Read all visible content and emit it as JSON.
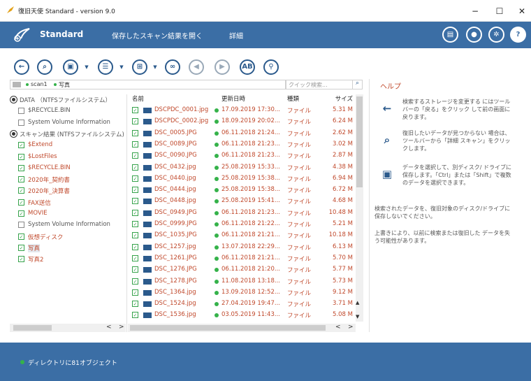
{
  "window": {
    "title": "復旧天使 Standard - version 9.0",
    "minimize": "−",
    "maximize": "☐",
    "close": "✕"
  },
  "header": {
    "brand": "Standard",
    "menu_open_scan": "保存したスキャン結果を開く",
    "menu_details": "詳細",
    "help_icon": "?"
  },
  "toolbar": {
    "case_button": "AB"
  },
  "breadcrumb": {
    "items": [
      "scan1",
      "写真"
    ]
  },
  "search": {
    "placeholder": "クイック検索..."
  },
  "tree": [
    {
      "label": "DATA （NTFSファイルシステム）",
      "type": "drive",
      "level": 0,
      "color": "grey"
    },
    {
      "label": "$RECYCLE.BIN",
      "type": "folder",
      "level": 1,
      "color": "grey"
    },
    {
      "label": "System Volume Information",
      "type": "folder",
      "level": 1,
      "color": "grey"
    },
    {
      "label": "スキャン結果 (NTFSファイルシステム)",
      "type": "drive",
      "level": 0,
      "color": "grey"
    },
    {
      "label": "$Extend",
      "type": "folder",
      "level": 1,
      "color": "red"
    },
    {
      "label": "$LostFiles",
      "type": "folder",
      "level": 1,
      "color": "red"
    },
    {
      "label": "$RECYCLE.BIN",
      "type": "folder",
      "level": 1,
      "color": "red"
    },
    {
      "label": "2020年_契約書",
      "type": "folder",
      "level": 1,
      "color": "red"
    },
    {
      "label": "2020年_決算書",
      "type": "folder",
      "level": 1,
      "color": "red"
    },
    {
      "label": "FAX送信",
      "type": "folder",
      "level": 1,
      "color": "red"
    },
    {
      "label": "MOVIE",
      "type": "folder",
      "level": 1,
      "color": "red"
    },
    {
      "label": "System Volume Information",
      "type": "folder",
      "level": 1,
      "color": "grey"
    },
    {
      "label": "仮想ディスク",
      "type": "folder",
      "level": 1,
      "color": "red"
    },
    {
      "label": "写真",
      "type": "folder",
      "level": 1,
      "color": "red",
      "selected": true
    },
    {
      "label": "写真2",
      "type": "folder",
      "level": 1,
      "color": "red"
    }
  ],
  "columns": {
    "name": "名前",
    "date": "更新日時",
    "kind": "種類",
    "size": "サイズ"
  },
  "files": [
    {
      "name": "DSCPDC_0001.jpg",
      "date": "17.09.2019 17:30...",
      "kind": "ファイル",
      "size": "5.31 M"
    },
    {
      "name": "DSCPDC_0002.jpg",
      "date": "18.09.2019 20:02...",
      "kind": "ファイル",
      "size": "6.24 M"
    },
    {
      "name": "DSC_0005.JPG",
      "date": "06.11.2018 21:24...",
      "kind": "ファイル",
      "size": "2.62 M"
    },
    {
      "name": "DSC_0089.JPG",
      "date": "06.11.2018 21:23...",
      "kind": "ファイル",
      "size": "3.02 M"
    },
    {
      "name": "DSC_0090.JPG",
      "date": "06.11.2018 21:23...",
      "kind": "ファイル",
      "size": "2.87 M"
    },
    {
      "name": "DSC_0432.jpg",
      "date": "25.08.2019 15:33...",
      "kind": "ファイル",
      "size": "4.38 M"
    },
    {
      "name": "DSC_0440.jpg",
      "date": "25.08.2019 15:38...",
      "kind": "ファイル",
      "size": "6.94 M"
    },
    {
      "name": "DSC_0444.jpg",
      "date": "25.08.2019 15:38...",
      "kind": "ファイル",
      "size": "6.72 M"
    },
    {
      "name": "DSC_0448.jpg",
      "date": "25.08.2019 15:41...",
      "kind": "ファイル",
      "size": "4.68 M"
    },
    {
      "name": "DSC_0949.JPG",
      "date": "06.11.2018 21:23...",
      "kind": "ファイル",
      "size": "10.48 M"
    },
    {
      "name": "DSC_0999.JPG",
      "date": "06.11.2018 21:22...",
      "kind": "ファイル",
      "size": "5.21 M"
    },
    {
      "name": "DSC_1035.JPG",
      "date": "06.11.2018 21:21...",
      "kind": "ファイル",
      "size": "10.18 M"
    },
    {
      "name": "DSC_1257.jpg",
      "date": "13.07.2018 22:29...",
      "kind": "ファイル",
      "size": "6.13 M"
    },
    {
      "name": "DSC_1261.JPG",
      "date": "06.11.2018 21:21...",
      "kind": "ファイル",
      "size": "5.70 M"
    },
    {
      "name": "DSC_1276.JPG",
      "date": "06.11.2018 21:20...",
      "kind": "ファイル",
      "size": "5.77 M"
    },
    {
      "name": "DSC_1278.JPG",
      "date": "11.08.2018 13:18...",
      "kind": "ファイル",
      "size": "5.73 M"
    },
    {
      "name": "DSC_1364.jpg",
      "date": "13.09.2018 12:52...",
      "kind": "ファイル",
      "size": "9.12 M"
    },
    {
      "name": "DSC_1524.jpg",
      "date": "27.04.2019 19:47...",
      "kind": "ファイル",
      "size": "3.71 M"
    },
    {
      "name": "DSC_1536.jpg",
      "date": "03.05.2019 11:43...",
      "kind": "ファイル",
      "size": "5.08 M"
    }
  ],
  "help": {
    "title": "ヘルプ",
    "item1": "検索するストレージを変更する にはツールバーの「戻る」をクリック して前の画面に戻ります。",
    "item2": "復旧したいデータが見つからない 場合は、ツールバーから「詳細 スキャン」をクリックします。",
    "item3": "データを選択して、別ディスク/ ドライブに保存します。「Ctrl」または「Shift」で複数 のデータを選択できます。",
    "note1": "検索されたデータを、復旧対象のディスク/ドライブに保存しないでください。",
    "note2": "上書きにより、以前に検索または復旧した データを失う可能性があります。"
  },
  "status": {
    "text": "ディレクトリに81オブジェクト"
  },
  "colors": {
    "header_bg": "#3b6ea5",
    "accent_red": "#c0482b",
    "ok_green": "#35b24a"
  }
}
